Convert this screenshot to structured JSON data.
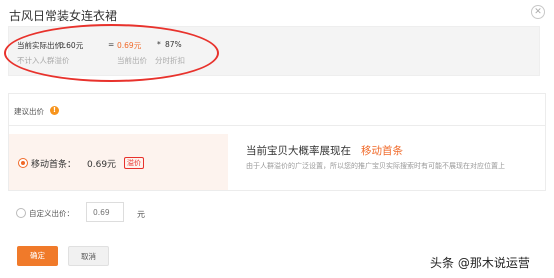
{
  "dialog": {
    "title": "古风日常装女连衣裙",
    "close_icon": "close-icon"
  },
  "formula": {
    "current_actual_price_label": "当前实际出价：",
    "current_actual_price_value": "0.60元",
    "equals": "=",
    "current_price_value": "0.69元",
    "times": "*",
    "discount_value": "87%",
    "note_no_crowd_premium": "不计入人群溢价",
    "note_current_price": "当前出价",
    "note_time_discount": "分时折扣"
  },
  "suggestion": {
    "label": "建议出价",
    "info_icon": "info-icon",
    "info_glyph": "!"
  },
  "mobile_first": {
    "label": "移动首条：",
    "price": "0.69元",
    "tag": "溢价",
    "selected": true
  },
  "description": {
    "title": "当前宝贝大概率展现在",
    "title_highlight": "移动首条",
    "text": "由于人群溢价的广泛设置，所以您的推广宝贝实际搜索时有可能不展现在对应位置上"
  },
  "custom_bid": {
    "label": "自定义出价：",
    "placeholder": "0.69",
    "unit": "元",
    "selected": false
  },
  "buttons": {
    "confirm": "确定",
    "cancel": "取消"
  },
  "watermark": "头条 @那木说运营",
  "colors": {
    "accent": "#f06a2a",
    "annotation_red": "#e8322c",
    "highlight_bg": "#fdf3ee"
  }
}
